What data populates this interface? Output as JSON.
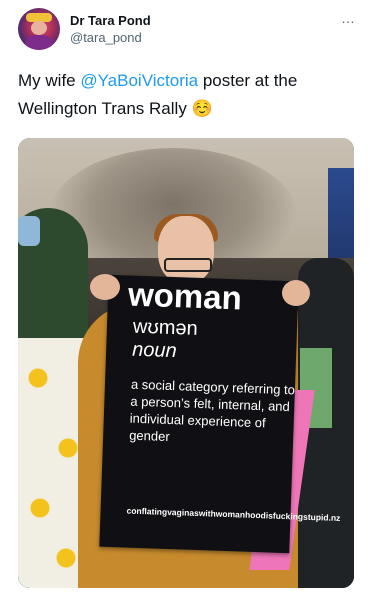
{
  "author": {
    "name": "Dr Tara Pond",
    "handle": "@tara_pond"
  },
  "more_icon": "…",
  "tweet": {
    "prefix": "My wife ",
    "mention": "@YaBoiVictoria",
    "suffix": " poster at the Wellington Trans Rally ☺️"
  },
  "poster": {
    "word": "woman",
    "pronunciation": "wʊmən",
    "part_of_speech": "noun",
    "definition": "a social category referring to a person’s felt, internal, and individual experience of gender",
    "tagline": "conflatingvaginaswithwomanhoodisfuckingstupid.nz"
  },
  "colors": {
    "accent": "#1d9bf0",
    "secondary_text": "#536471"
  }
}
